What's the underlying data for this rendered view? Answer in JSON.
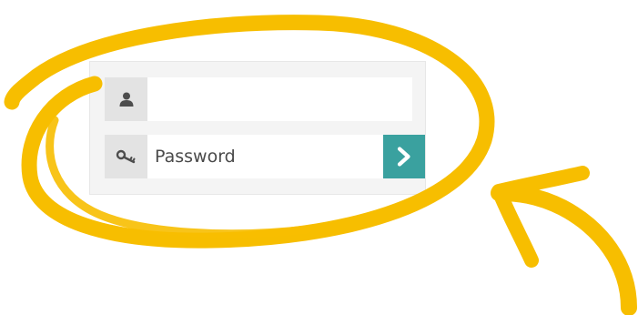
{
  "login": {
    "username": {
      "value": "",
      "placeholder": "",
      "icon": "user-icon"
    },
    "password": {
      "value": "",
      "placeholder": "Password",
      "icon": "key-icon"
    },
    "submit": {
      "icon": "chevron-right-icon",
      "color": "#3aa19f"
    }
  },
  "annotation": {
    "color": "#f7be00"
  }
}
